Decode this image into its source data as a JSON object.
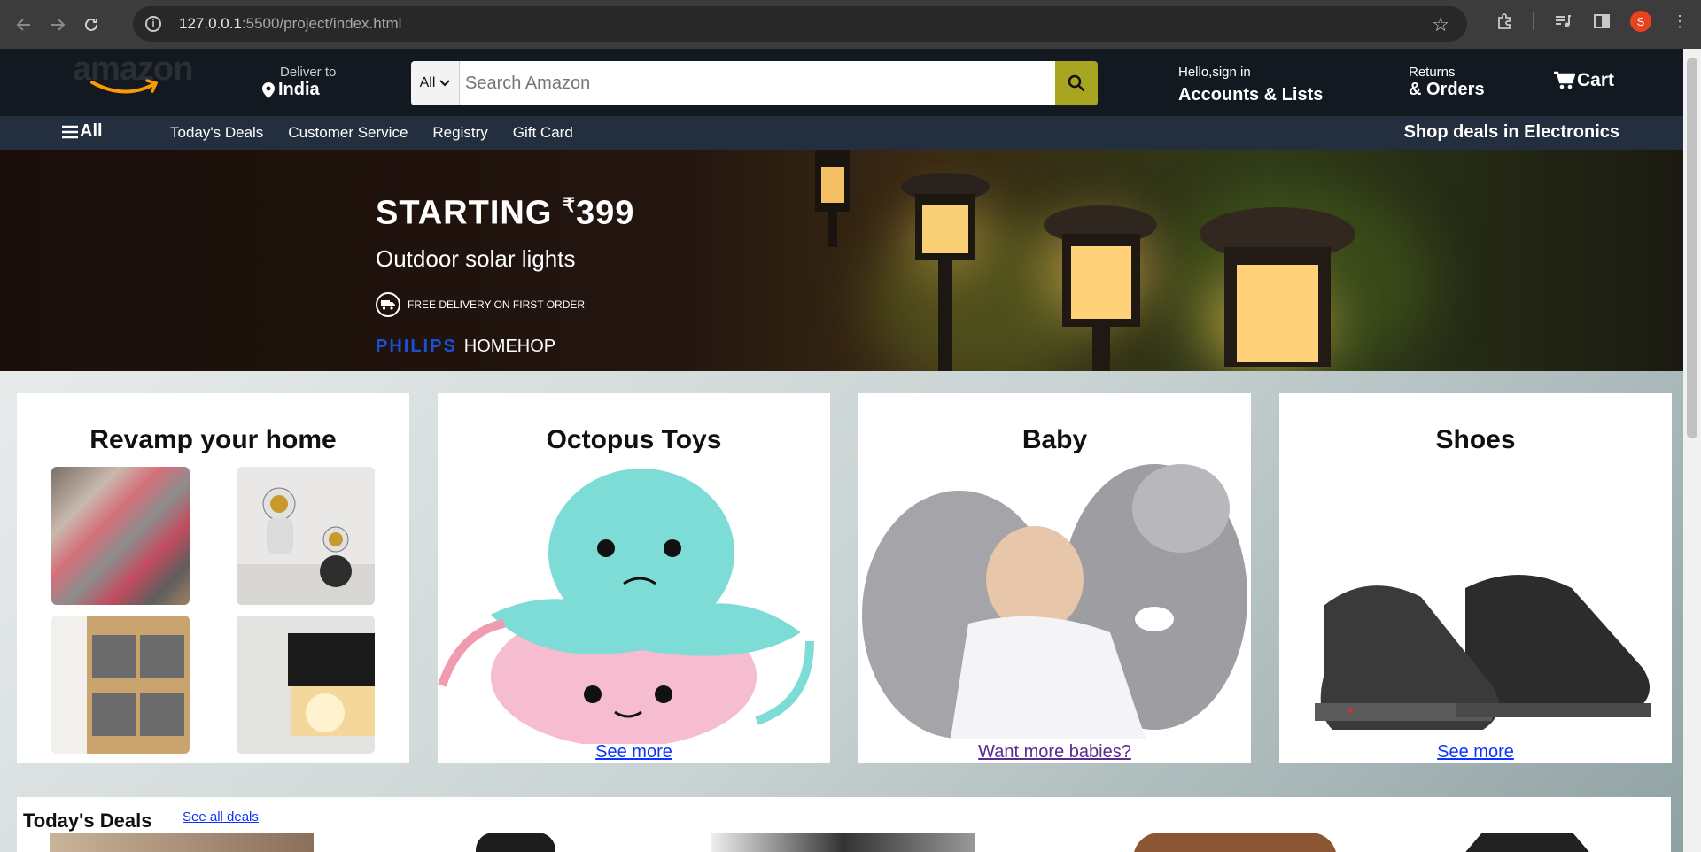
{
  "browser": {
    "url_host": "127.0.0.1",
    "url_rest": ":5500/project/index.html",
    "profile_initial": "S"
  },
  "header": {
    "logo_text": "amazon",
    "deliver_label": "Deliver to",
    "deliver_location": "India",
    "search_category": "All",
    "search_placeholder": "Search Amazon",
    "account_greeting": "Hello,sign in",
    "account_label": "Accounts & Lists",
    "returns_label": "Returns",
    "orders_label": "& Orders",
    "cart_label": "Cart"
  },
  "subnav": {
    "all_label": "All",
    "links": [
      "Today's Deals",
      "Customer Service",
      "Registry",
      "Gift Card"
    ],
    "promo": "Shop deals in Electronics"
  },
  "hero": {
    "headline": "STARTING",
    "currency": "₹",
    "price": "399",
    "subtitle": "Outdoor solar lights",
    "delivery_note": "FREE DELIVERY ON FIRST ORDER",
    "brand_primary": "PHILIPS",
    "brand_secondary": "HOMEHOP"
  },
  "cards": [
    {
      "title": "Revamp your home",
      "link": ""
    },
    {
      "title": "Octopus Toys",
      "link": "See more"
    },
    {
      "title": "Baby",
      "link": "Want more babies?"
    },
    {
      "title": "Shoes",
      "link": "See more"
    }
  ],
  "deals": {
    "title": "Today's Deals",
    "see_all": "See all deals"
  },
  "colors": {
    "nav_dark": "#131921",
    "nav_secondary": "#232f3e",
    "search_button": "#a8a620",
    "link": "#0b33ff",
    "link_visited": "#5a2b8a"
  }
}
